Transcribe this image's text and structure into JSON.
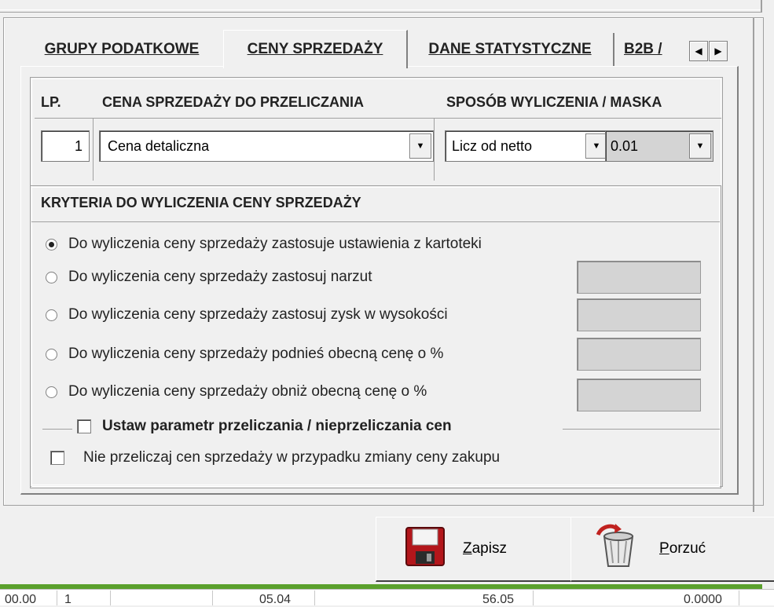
{
  "tabs": [
    {
      "label": "GRUPY PODATKOWE"
    },
    {
      "label": "CENY SPRZEDAŻY"
    },
    {
      "label": "DANE STATYSTYCZNE"
    },
    {
      "label": "B2B /"
    }
  ],
  "tab_scroll": {
    "left_icon": "◀",
    "right_icon": "▶"
  },
  "headers": {
    "lp": "LP.",
    "cena": "CENA SPRZEDAŻY  DO PRZELICZANIA",
    "sposob": "SPOSÓB WYLICZENIA / MASKA"
  },
  "row": {
    "lp": "1",
    "cena": "Cena detaliczna",
    "sposob": "Licz od netto",
    "maska": "0.01"
  },
  "kryteria": {
    "title": "KRYTERIA DO WYLICZENIA CENY SPRZEDAŻY",
    "options": [
      {
        "label": "Do wyliczenia ceny sprzedaży zastosuje ustawienia z kartoteki",
        "checked": true
      },
      {
        "label": "Do wyliczenia ceny sprzedaży zastosuj  narzut",
        "checked": false
      },
      {
        "label": "Do wyliczenia ceny sprzedaży zastosuj zysk w wysokości",
        "checked": false
      },
      {
        "label": "Do wyliczenia ceny sprzedaży podnieś obecną cenę o %",
        "checked": false
      },
      {
        "label": "Do wyliczenia ceny sprzedaży obniż obecną cenę o %",
        "checked": false
      }
    ],
    "ustaw_label": "Ustaw parametr przeliczania / nieprzeliczania cen",
    "nie_label": "Nie przeliczaj cen sprzedaży w przypadku zmiany ceny zakupu"
  },
  "buttons": {
    "zapisz_hotkey": "Z",
    "zapisz_rest": "apisz",
    "porzuc_hotkey": "P",
    "porzuc_rest": "orzuć"
  },
  "dropdown_icon": "▼",
  "bottom_cells": [
    "00.00",
    "1",
    "05.04",
    "56.05",
    "0.0000"
  ],
  "colors": {
    "status_strip": "#5aa02c",
    "save_icon": "#b3161b"
  }
}
